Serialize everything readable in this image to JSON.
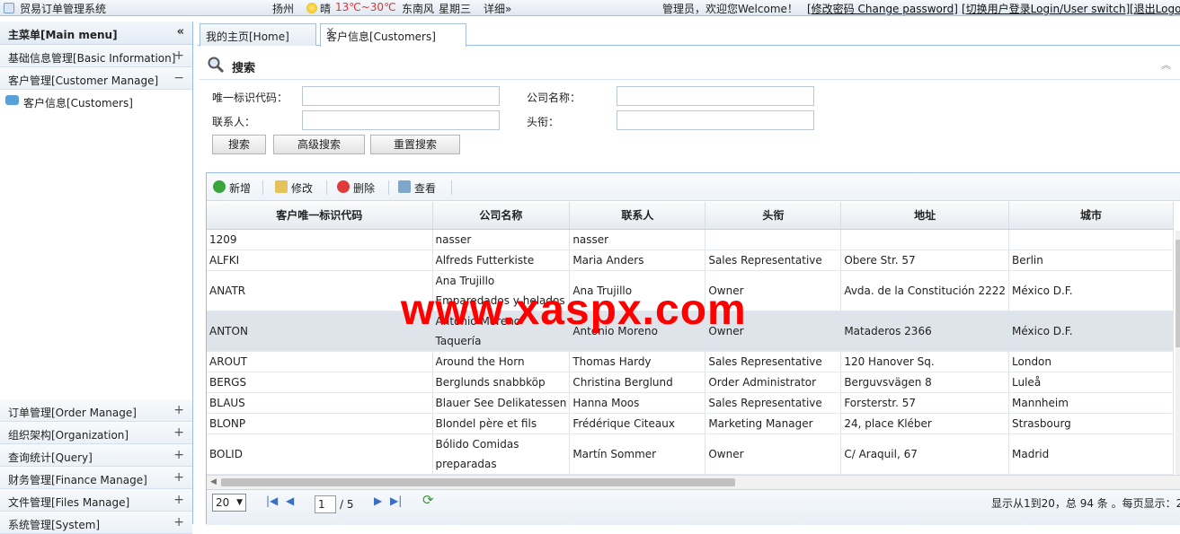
{
  "topbar": {
    "app_title": "贸易订单管理系统",
    "city": "扬州",
    "weather": "晴",
    "temp": "13℃~30℃",
    "wind": "东南风",
    "weekday": "星期三",
    "detail": "详细»",
    "greeting": "管理员，欢迎您Welcome！",
    "change_password": "[修改密码 Change password]",
    "switch_user": "[切换用户登录Login/User switch]",
    "logout": "[退出Logo"
  },
  "sidebar": {
    "header": "主菜单[Main menu]",
    "collapse_glyph": "«",
    "items": [
      {
        "label": "基础信息管理[Basic Information]",
        "sign": "+"
      },
      {
        "label": "客户管理[Customer Manage]",
        "sign": "−"
      }
    ],
    "subitem": "客户信息[Customers]",
    "bottom_items": [
      {
        "label": "订单管理[Order Manage]",
        "sign": "+"
      },
      {
        "label": "组织架构[Organization]",
        "sign": "+"
      },
      {
        "label": "查询统计[Query]",
        "sign": "+"
      },
      {
        "label": "财务管理[Finance Manage]",
        "sign": "+"
      },
      {
        "label": "文件管理[Files Manage]",
        "sign": "+"
      },
      {
        "label": "系统管理[System]",
        "sign": "+"
      }
    ]
  },
  "tabs": {
    "home": "我的主页[Home]",
    "customers": "客户信息[Customers]",
    "close": "✕"
  },
  "search": {
    "title": "搜索",
    "collapse": "︽",
    "label_id": "唯一标识代码：",
    "label_company": "公司名称：",
    "label_contact": "联系人：",
    "label_title": "头衔：",
    "btn_search": "搜索",
    "btn_advanced": "高级搜索",
    "btn_reset": "重置搜索"
  },
  "toolbar": {
    "add": "新增",
    "edit": "修改",
    "delete": "删除",
    "view": "查看"
  },
  "grid": {
    "columns": [
      "客户唯一标识代码",
      "公司名称",
      "联系人",
      "头衔",
      "地址",
      "城市"
    ],
    "rows": [
      [
        "1209",
        "nasser",
        "nasser",
        "",
        "",
        ""
      ],
      [
        "ALFKI",
        "Alfreds Futterkiste",
        "Maria Anders",
        "Sales Representative",
        "Obere Str. 57",
        "Berlin"
      ],
      [
        "ANATR",
        "Ana Trujillo Emparedados y helados",
        "Ana Trujillo",
        "Owner",
        "Avda. de la Constitución 2222",
        "México D.F."
      ],
      [
        "ANTON",
        "Antonio Moreno Taquería",
        "Antonio Moreno",
        "Owner",
        "Mataderos 2366",
        "México D.F."
      ],
      [
        "AROUT",
        "Around the Horn",
        "Thomas Hardy",
        "Sales Representative",
        "120 Hanover Sq.",
        "London"
      ],
      [
        "BERGS",
        "Berglunds snabbköp",
        "Christina Berglund",
        "Order Administrator",
        "Berguvsvägen 8",
        "Luleå"
      ],
      [
        "BLAUS",
        "Blauer See Delikatessen",
        "Hanna Moos",
        "Sales Representative",
        "Forsterstr. 57",
        "Mannheim"
      ],
      [
        "BLONP",
        "Blondel père et fils",
        "Frédérique Citeaux",
        "Marketing Manager",
        "24, place Kléber",
        "Strasbourg"
      ],
      [
        "BOLID",
        "Bólido Comidas preparadas",
        "Martín Sommer",
        "Owner",
        "C/ Araquil, 67",
        "Madrid"
      ]
    ]
  },
  "pager": {
    "page_size": "20",
    "current_page": "1",
    "total_pages": "/ 5",
    "summary": "显示从1到20，总 94 条 。每页显示：2"
  },
  "watermark": "www.xaspx.com",
  "colors": {
    "accent": "#99bbe8",
    "watermark": "#ff0000",
    "selected_row": "#dfe3ea"
  }
}
